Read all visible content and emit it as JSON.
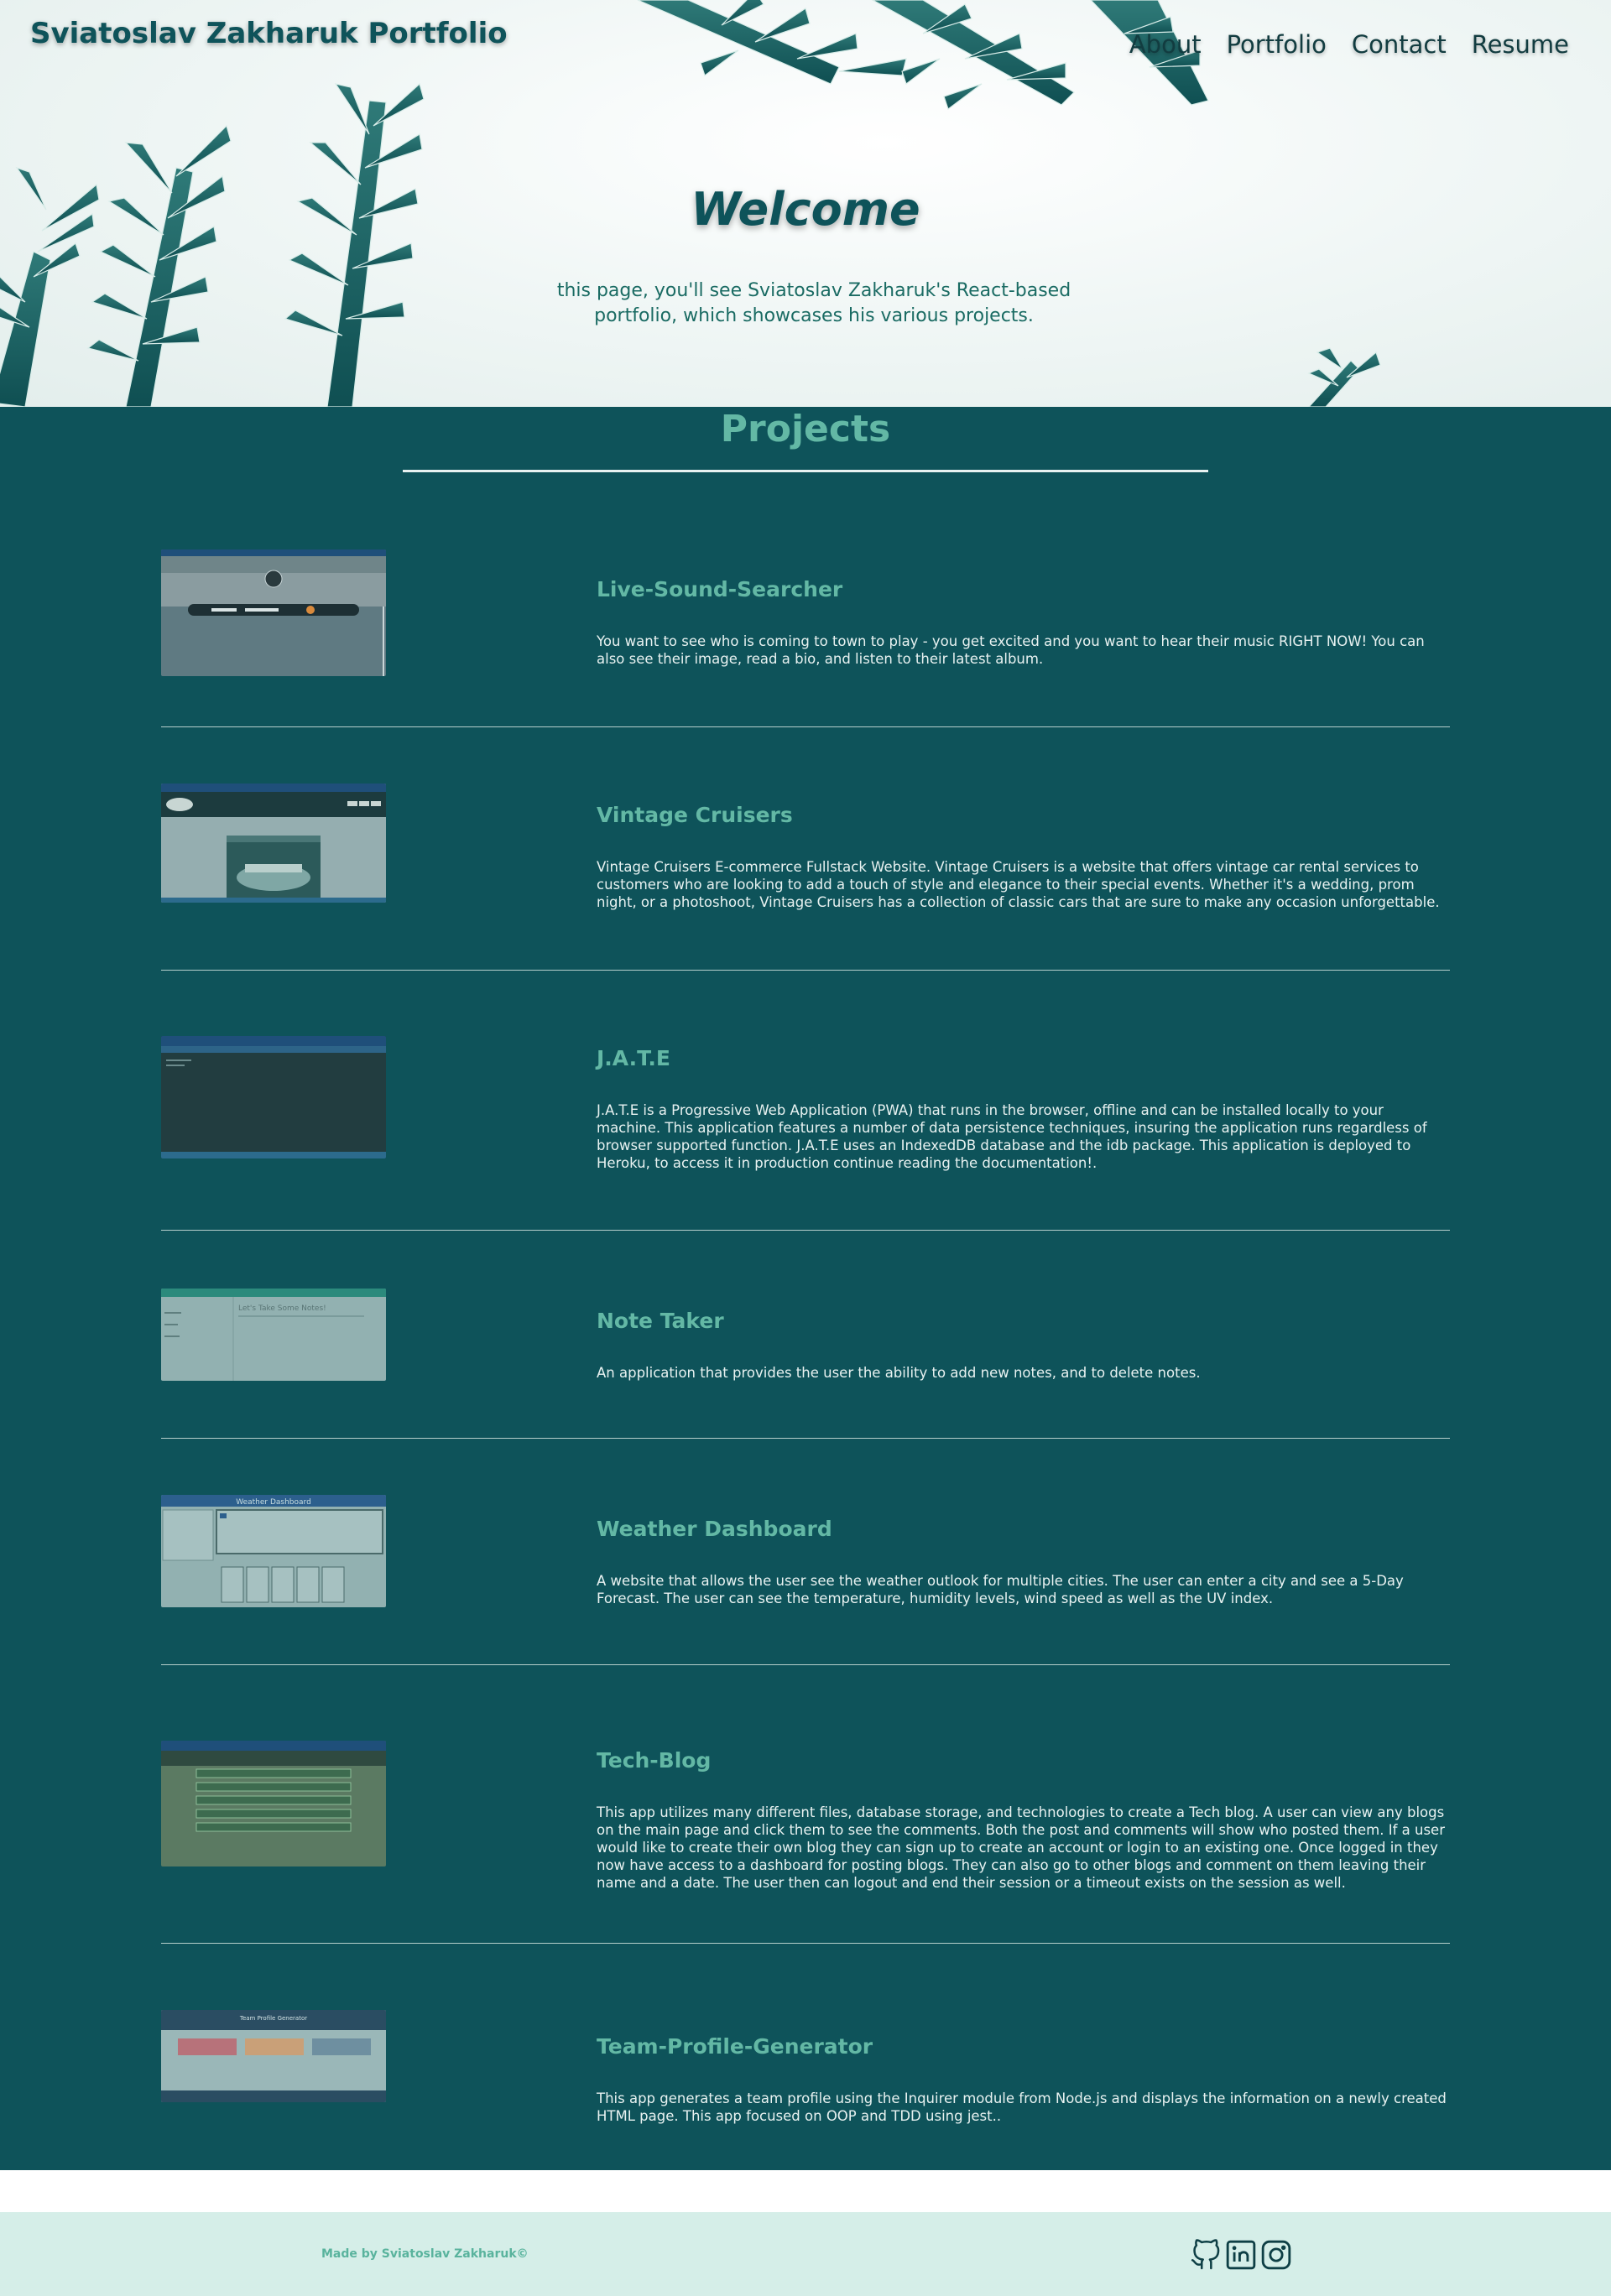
{
  "header": {
    "brand": "Sviatoslav Zakharuk Portfolio",
    "nav": [
      "About",
      "Portfolio",
      "Contact",
      "Resume"
    ]
  },
  "hero": {
    "title": "Welcome",
    "intro": "this page, you'll see Sviatoslav Zakharuk's React-based portfolio, which showcases his various projects."
  },
  "projects": {
    "title": "Projects",
    "items": [
      {
        "name": "Live-Sound-Searcher",
        "description": "You want to see who is coming to town to play - you get excited and you want to hear their music RIGHT NOW! You can also see their image, read a bio, and listen to their latest album.",
        "thumb": "screenshot of Live-Sound-Searcher app"
      },
      {
        "name": "Vintage Cruisers",
        "description": "Vintage Cruisers E-commerce Fullstack Website. Vintage Cruisers is a website that offers vintage car rental services to customers who are looking to add a touch of style and elegance to their special events. Whether it's a wedding, prom night, or a photoshoot, Vintage Cruisers has a collection of classic cars that are sure to make any occasion unforgettable.",
        "thumb": "screenshot of Vintage Cruisers website"
      },
      {
        "name": "J.A.T.E",
        "description": "J.A.T.E is a Progressive Web Application (PWA) that runs in the browser, offline and can be installed locally to your machine. This application features a number of data persistence techniques, insuring the application runs regardless of browser supported function. J.A.T.E uses an IndexedDB database and the idb package. This application is deployed to Heroku, to access it in production continue reading the documentation!.",
        "thumb": "screenshot of J.A.T.E editor"
      },
      {
        "name": "Note Taker",
        "description": "An application that provides the user the ability to add new notes, and to delete notes.",
        "thumb": "screenshot of Note Taker app"
      },
      {
        "name": "Weather Dashboard",
        "description": "A website that allows the user see the weather outlook for multiple cities. The user can enter a city and see a 5-Day Forecast. The user can see the temperature, humidity levels, wind speed as well as the UV index.",
        "thumb": "screenshot of Weather Dashboard"
      },
      {
        "name": "Tech-Blog",
        "description": "This app utilizes many different files, database storage, and technologies to create a Tech blog. A user can view any blogs on the main page and click them to see the comments. Both the post and comments will show who posted them. If a user would like to create their own blog they can sign up to create an account or login to an existing one. Once logged in they now have access to a dashboard for posting blogs. They can also go to other blogs and comment on them leaving their name and a date. The user then can logout and end their session or a timeout exists on the session as well.",
        "thumb": "screenshot of Tech-Blog"
      },
      {
        "name": "Team-Profile-Generator",
        "description": "This app generates a team profile using the Inquirer module from Node.js and displays the information on a newly created HTML page. This app focused on OOP and TDD using jest..",
        "thumb": "screenshot of Team-Profile-Generator"
      }
    ],
    "thumb_labels": {
      "weather_header": "Weather Dashboard",
      "notes_header": "Let's Take Some Notes!",
      "team_header": "Team Profile Generator"
    }
  },
  "footer": {
    "credit": "Made by Sviatoslav Zakharuk©",
    "social": [
      "github-icon",
      "linkedin-icon",
      "instagram-icon"
    ]
  },
  "colors": {
    "primary_dark": "#0e535a",
    "accent": "#63b8a5",
    "footer_bg": "#d5eee8",
    "text_light": "#e8f2f1"
  }
}
